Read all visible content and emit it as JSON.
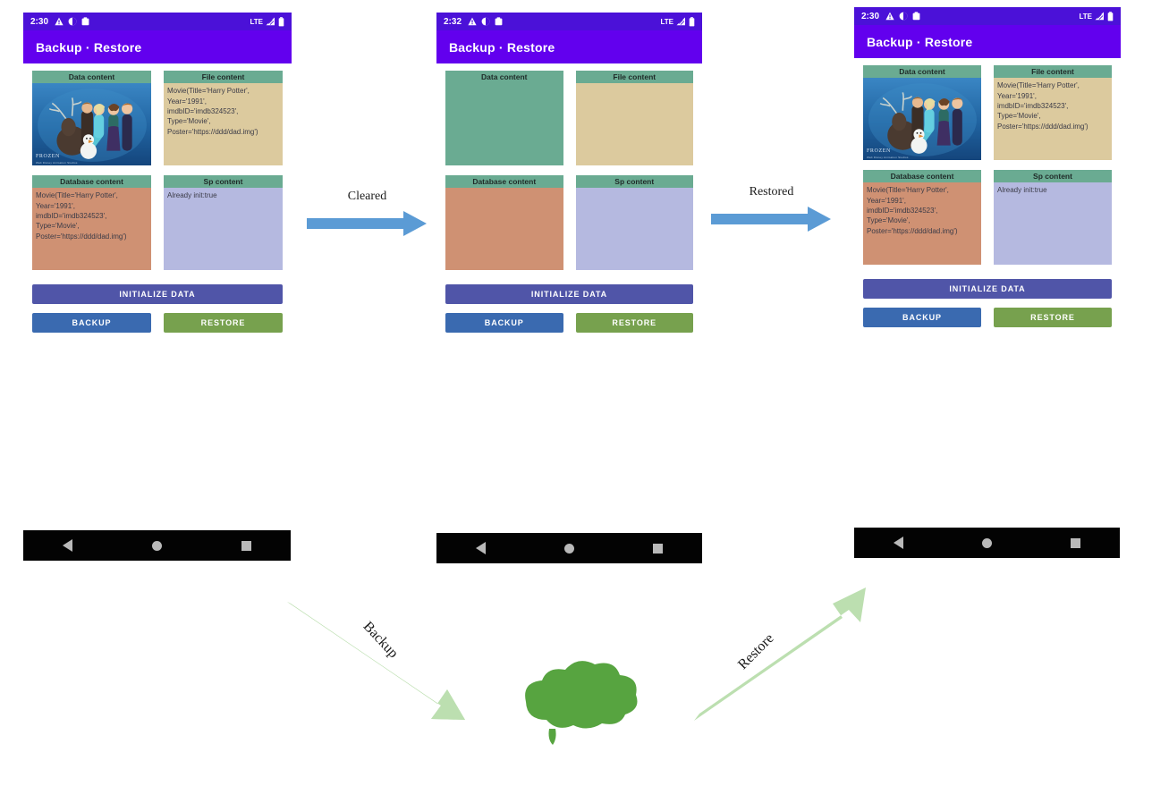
{
  "app": {
    "title": "Backup · Restore"
  },
  "phones": [
    {
      "id": "phone-initial",
      "status": {
        "time": "2:30",
        "network": "LTE"
      },
      "cards": [
        {
          "name": "data",
          "header": "Data content",
          "body": "",
          "poster": {
            "label": "FROZEN",
            "sub": "Walt Disney Animation Studios"
          }
        },
        {
          "name": "file",
          "header": "File content",
          "body": "Movie(Title='Harry Potter', Year='1991', imdbID='imdb324523', Type='Movie', Poster='https://ddd/dad.img')"
        },
        {
          "name": "database",
          "header": "Database content",
          "body": "Movie(Title='Harry Potter', Year='1991', imdbID='imdb324523', Type='Movie', Poster='https://ddd/dad.img')"
        },
        {
          "name": "sp",
          "header": "Sp content",
          "body": "Already init:true"
        }
      ],
      "buttons": {
        "initialize": "INITIALIZE DATA",
        "backup": "BACKUP",
        "restore": "RESTORE"
      }
    },
    {
      "id": "phone-cleared",
      "status": {
        "time": "2:32",
        "network": "LTE"
      },
      "cards": [
        {
          "name": "data",
          "header": "Data content",
          "body": "",
          "poster": null
        },
        {
          "name": "file",
          "header": "File content",
          "body": ""
        },
        {
          "name": "database",
          "header": "Database content",
          "body": ""
        },
        {
          "name": "sp",
          "header": "Sp content",
          "body": ""
        }
      ],
      "buttons": {
        "initialize": "INITIALIZE DATA",
        "backup": "BACKUP",
        "restore": "RESTORE"
      }
    },
    {
      "id": "phone-restored",
      "status": {
        "time": "2:30",
        "network": "LTE"
      },
      "cards": [
        {
          "name": "data",
          "header": "Data content",
          "body": "",
          "poster": {
            "label": "FROZEN",
            "sub": "Walt Disney Animation Studios"
          }
        },
        {
          "name": "file",
          "header": "File content",
          "body": "Movie(Title='Harry Potter', Year='1991', imdbID='imdb324523', Type='Movie', Poster='https://ddd/dad.img')"
        },
        {
          "name": "database",
          "header": "Database content",
          "body": "Movie(Title='Harry Potter', Year='1991', imdbID='imdb324523', Type='Movie', Poster='https://ddd/dad.img')"
        },
        {
          "name": "sp",
          "header": "Sp content",
          "body": "Already init:true"
        }
      ],
      "buttons": {
        "initialize": "INITIALIZE DATA",
        "backup": "BACKUP",
        "restore": "RESTORE"
      }
    }
  ],
  "flows": [
    {
      "id": "flow-cleared",
      "label": "Cleared"
    },
    {
      "id": "flow-restored",
      "label": "Restored"
    }
  ],
  "diagram": {
    "backup_label": "Backup",
    "restore_label": "Restore",
    "cloud_name": "cloud-storage"
  },
  "colors": {
    "app_bar": "#6200ee",
    "status_bar": "#4b11d8",
    "card_header": "#6aab92",
    "file_body": "#dcca9e",
    "db_body": "#cf9173",
    "sp_body": "#b5b9e0",
    "data_body": "#6aab92",
    "btn_initialize": "#5055a8",
    "btn_backup": "#3a6ab0",
    "btn_restore": "#77a14e",
    "flow_arrow": "#5b9bd5",
    "diagram_arrow": "#bcdfb0",
    "cloud": "#57a440"
  }
}
